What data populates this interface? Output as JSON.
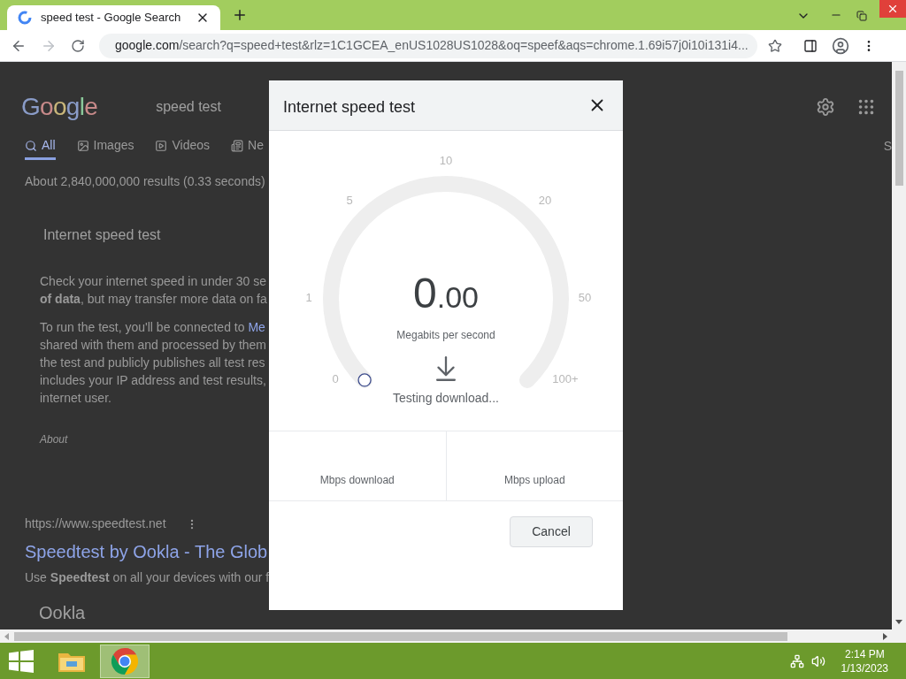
{
  "browser": {
    "tab_title": "speed test - Google Search",
    "url_host": "google.com",
    "url_rest": "/search?q=speed+test&rlz=1C1GCEA_enUS1028US1028&oq=speef&aqs=chrome.1.69i57j0i10i131i4..."
  },
  "page": {
    "logo": "Google",
    "search_query": "speed test",
    "tabs": [
      {
        "label": "All",
        "selected": true
      },
      {
        "label": "Images",
        "selected": false
      },
      {
        "label": "Videos",
        "selected": false
      },
      {
        "label": "Ne",
        "selected": false
      }
    ],
    "edge_tab": "S",
    "results_count": "About 2,840,000,000 results (0.33 seconds)",
    "card": {
      "title": "Internet speed test",
      "paragraphs": [
        [
          {
            "text": "Check your internet speed in under 30 se"
          },
          {
            "text": "**of data**, but may transfer more data on fa"
          }
        ],
        [
          {
            "text": "To run the test, you'll be connected to ",
            "link": "Me"
          },
          {
            "text": "shared with them and processed by them"
          },
          {
            "text": "the test and publicly publishes all test res"
          },
          {
            "text": "includes your IP address and test results,"
          },
          {
            "text": "internet user."
          }
        ]
      ],
      "about": "About"
    },
    "result": {
      "url": "https://www.speedtest.net",
      "title": "Speedtest by Ookla - The Glob",
      "snippet": "Use **Speedtest** on all your devices with our f",
      "sitelink": "Ookla"
    }
  },
  "dialog": {
    "title": "Internet speed test",
    "ticks": [
      "0",
      "1",
      "5",
      "10",
      "20",
      "50",
      "100+"
    ],
    "value_whole": "0",
    "value_fraction": ".00",
    "unit": "Megabits per second",
    "status": "Testing download...",
    "download_label": "Mbps download",
    "upload_label": "Mbps upload",
    "cancel": "Cancel"
  },
  "taskbar": {
    "time": "2:14 PM",
    "date": "1/13/2023"
  }
}
